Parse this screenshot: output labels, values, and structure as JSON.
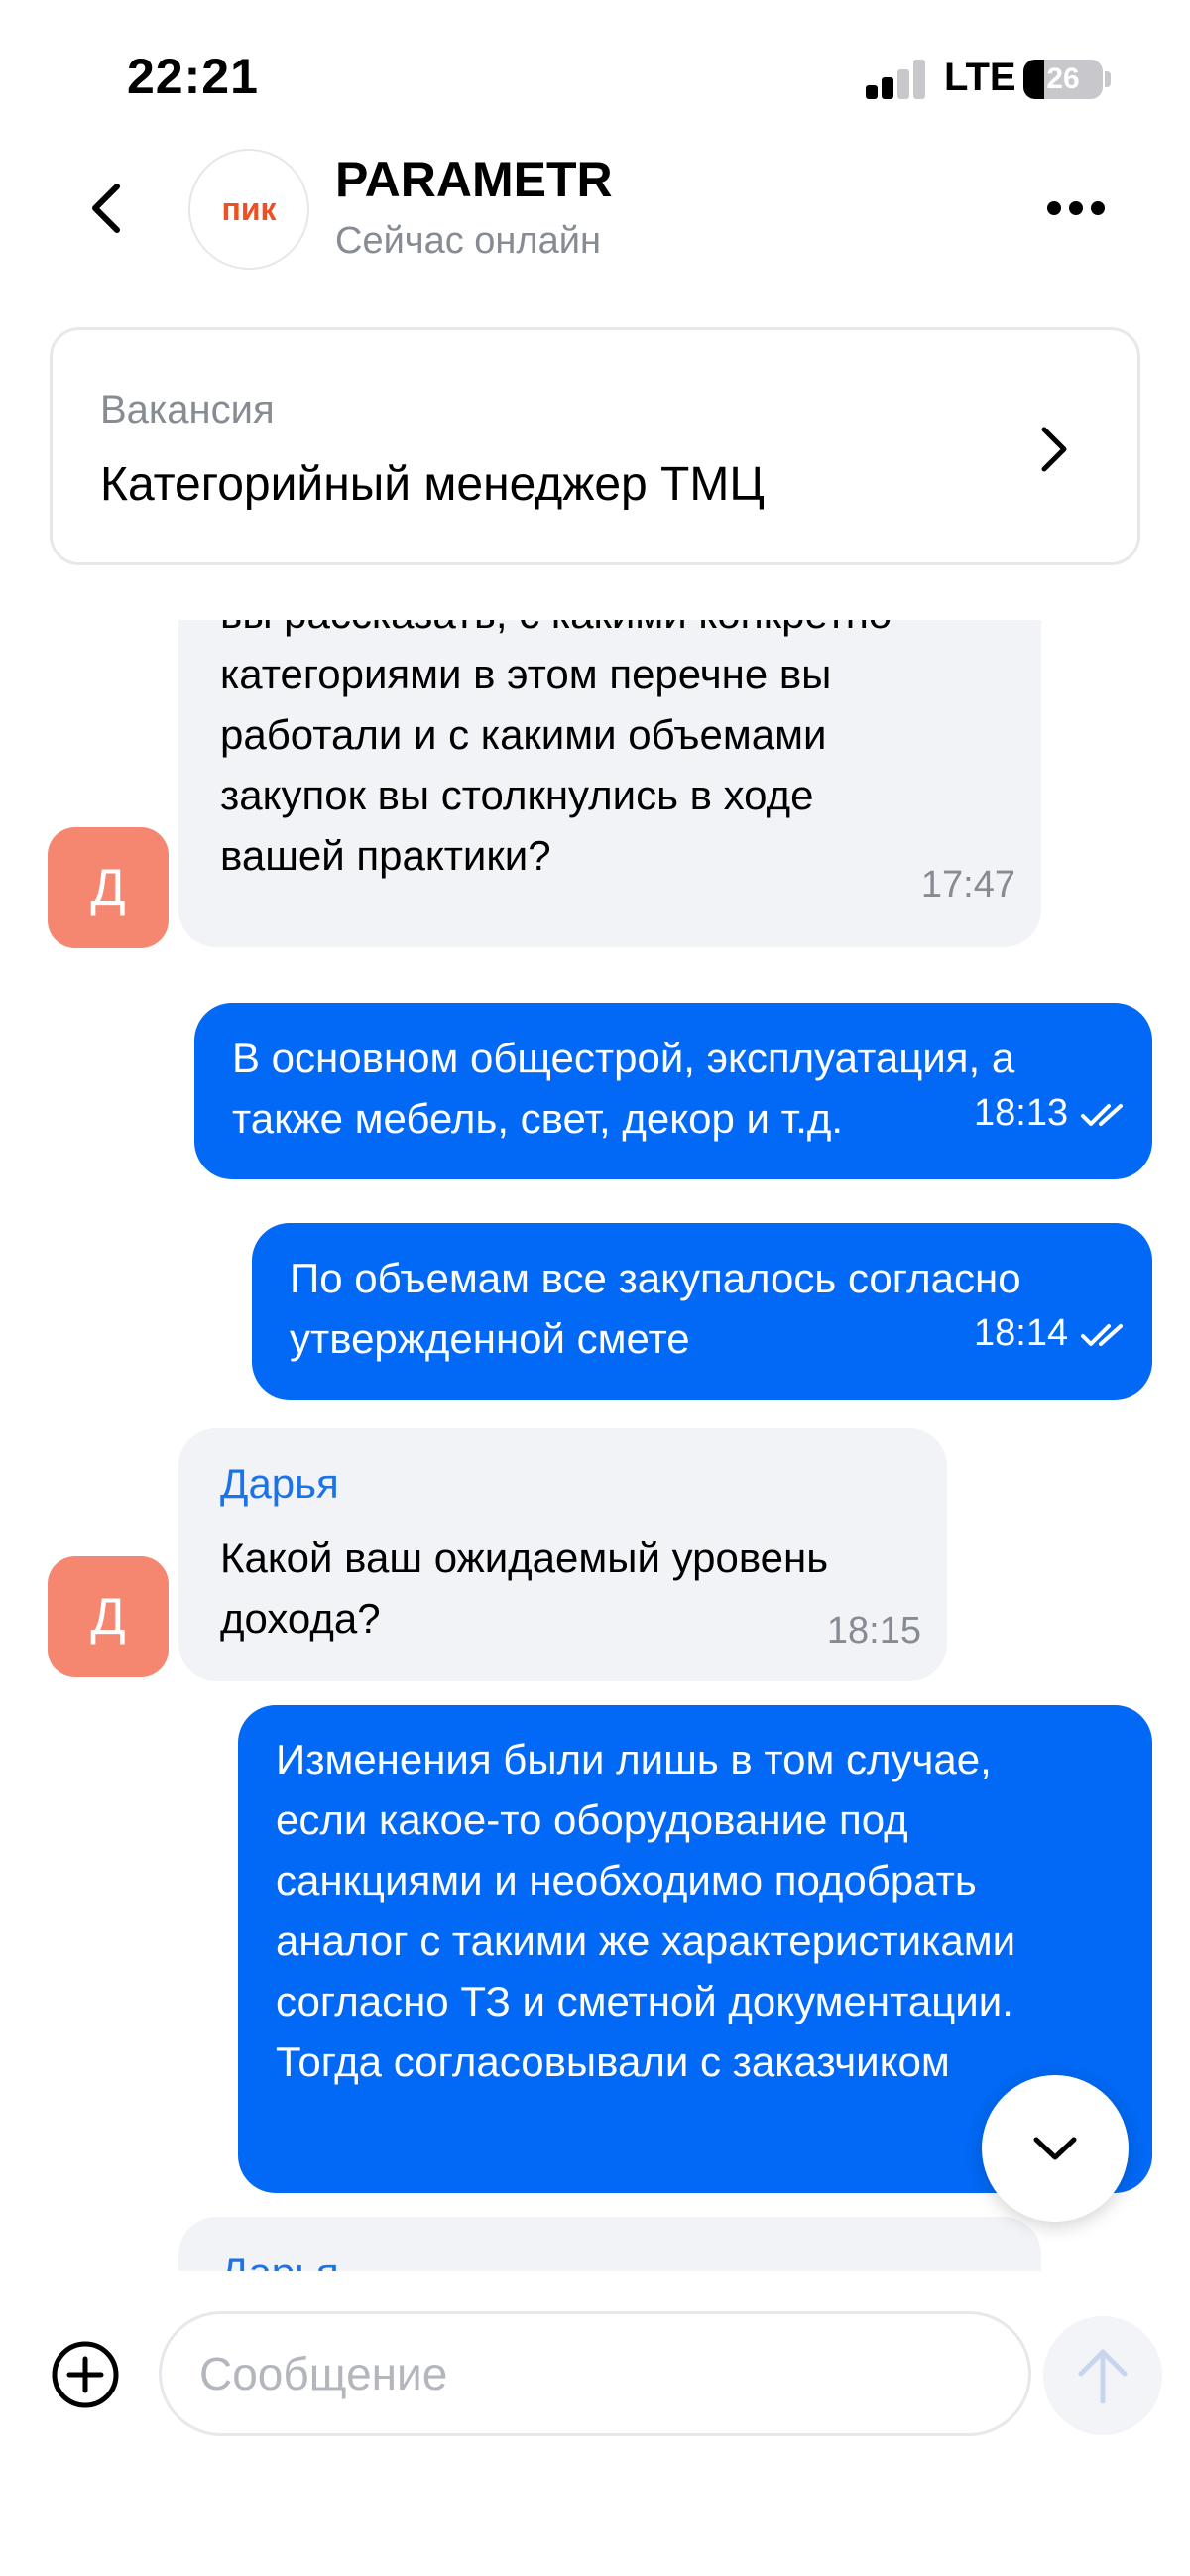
{
  "status_bar": {
    "time": "22:21",
    "network": "LTE",
    "battery": "26",
    "battery_level_percent": 26
  },
  "header": {
    "logo_text": "пик",
    "title": "PARAMETR",
    "subtitle": "Сейчас онлайн",
    "back_icon": "chevron-left-icon",
    "more_icon": "more-horizontal-icon"
  },
  "vacancy": {
    "label": "Вакансия",
    "title": "Категорийный менеджер ТМЦ"
  },
  "messages": [
    {
      "direction": "incoming",
      "lines": [
        "вы рассказать, с какими конкретно",
        "категориями в этом перечне вы",
        "работали и с какими объемами",
        "закупок вы столкнулись в ходе",
        "вашей практики?"
      ],
      "time": "17:47",
      "avatar_letter": "Д"
    },
    {
      "direction": "outgoing",
      "lines": [
        "В основном общестрой, эксплуатация, а",
        "также мебель, свет, декор и т.д."
      ],
      "time": "18:13"
    },
    {
      "direction": "outgoing",
      "lines": [
        "По объемам все закупалось согласно",
        "утвержденной смете"
      ],
      "time": "18:14"
    },
    {
      "direction": "incoming",
      "sender": "Дарья",
      "lines": [
        "Какой ваш ожидаемый уровень",
        "дохода?"
      ],
      "time": "18:15",
      "avatar_letter": "Д"
    },
    {
      "direction": "outgoing",
      "lines": [
        "Изменения были лишь в том случае,",
        "если какое-то оборудование под",
        "санкциями и необходимо подобрать",
        "аналог с такими же характеристиками",
        "согласно ТЗ и сметной документации.",
        "Тогда согласовывали с заказчиком"
      ],
      "time": ""
    },
    {
      "direction": "incoming",
      "sender": "Дарья",
      "lines": []
    }
  ],
  "composer": {
    "placeholder": "Сообщение",
    "value": "",
    "plus_icon": "plus-circle-icon",
    "send_icon": "arrow-up-icon"
  },
  "colors": {
    "accent": "#0169f5",
    "incoming_bubble": "#f2f3f7",
    "avatar": "#f58670",
    "logo": "#f04f23",
    "sender_name": "#1a73e8"
  }
}
